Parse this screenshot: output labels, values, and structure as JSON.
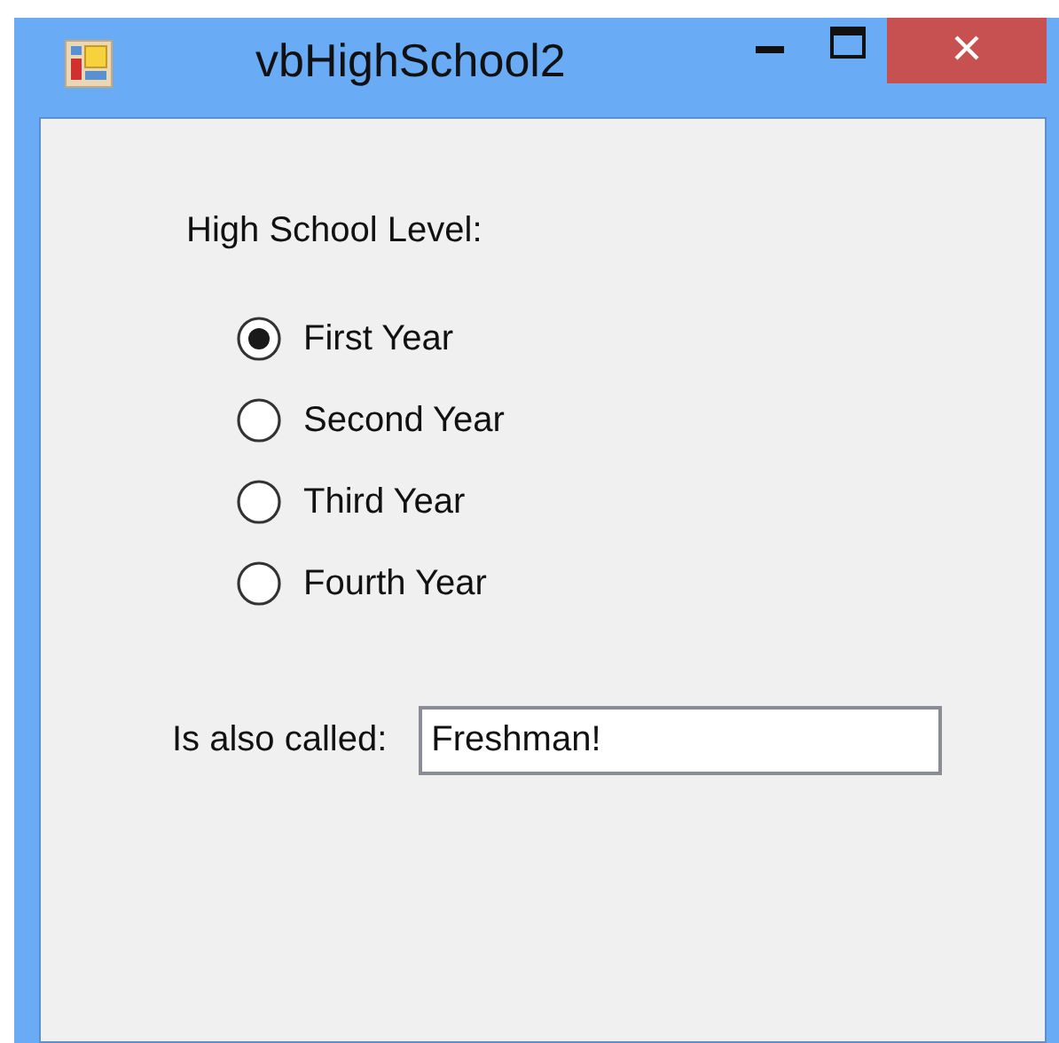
{
  "window": {
    "title": "vbHighSchool2"
  },
  "group_label": "High School Level:",
  "options": [
    {
      "label": "First Year",
      "selected": true
    },
    {
      "label": "Second Year",
      "selected": false
    },
    {
      "label": "Third Year",
      "selected": false
    },
    {
      "label": "Fourth Year",
      "selected": false
    }
  ],
  "field": {
    "label": "Is also called:",
    "value": "Freshman!"
  }
}
